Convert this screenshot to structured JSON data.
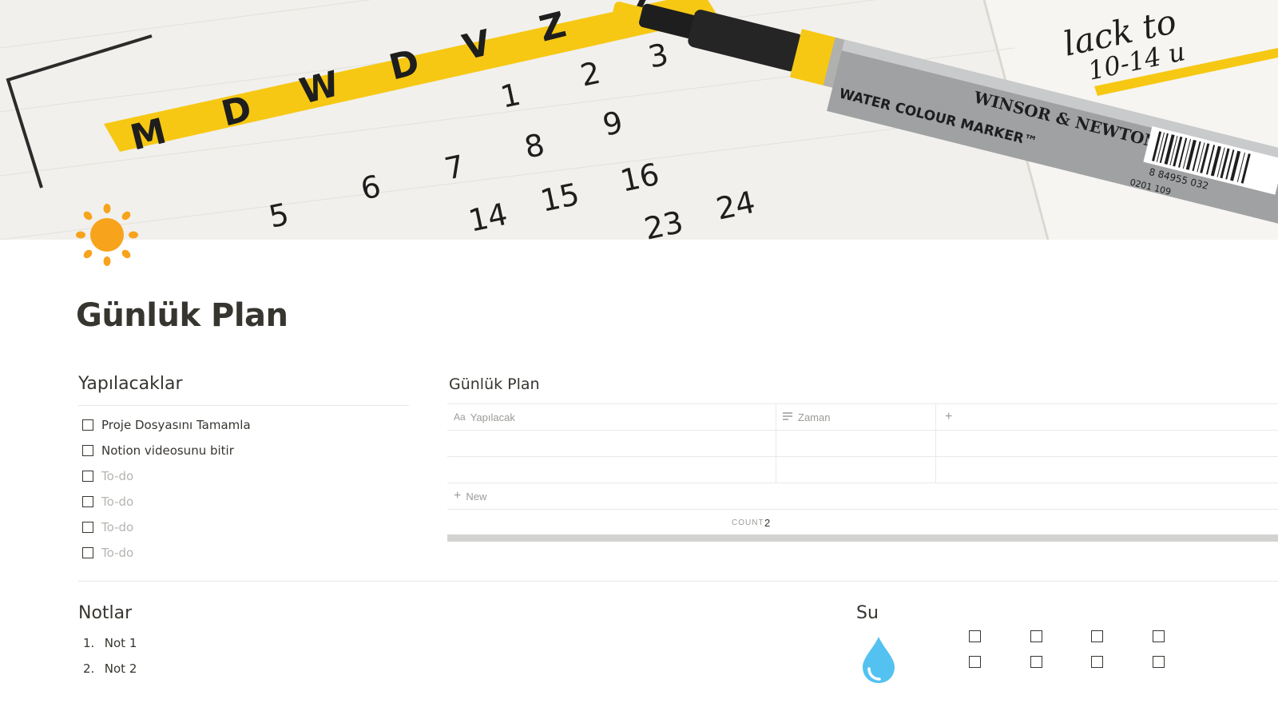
{
  "page": {
    "icon": "sun-icon",
    "title": "Günlük Plan",
    "cover": {
      "weekday_letters": [
        "M",
        "D",
        "W",
        "D",
        "V",
        "Z",
        "Z"
      ],
      "calendar_numbers": [
        "1",
        "2",
        "3",
        "5",
        "6",
        "7",
        "8",
        "9",
        "14",
        "15",
        "16",
        "23",
        "24"
      ],
      "marker_text_top": "WINSOR & NEWTON",
      "marker_text_main": "WATER COLOUR MARKER™",
      "barcode_number": "8 84955 032",
      "marker_code": "0201 109",
      "note_line_1": "lack to",
      "note_line_2": "10-14 u"
    }
  },
  "todo_section": {
    "heading": "Yapılacaklar",
    "items": [
      {
        "label": "Proje Dosyasını Tamamla",
        "placeholder": false
      },
      {
        "label": "Notion videosunu bitir",
        "placeholder": false
      },
      {
        "label": "To-do",
        "placeholder": true
      },
      {
        "label": "To-do",
        "placeholder": true
      },
      {
        "label": "To-do",
        "placeholder": true
      },
      {
        "label": "To-do",
        "placeholder": true
      }
    ]
  },
  "database": {
    "title": "Günlük Plan",
    "columns": [
      {
        "name": "Yapılacak",
        "icon": "Aa"
      },
      {
        "name": "Zaman",
        "icon": "text-lines-icon"
      }
    ],
    "add_column_icon": "plus-icon",
    "row_count": 2,
    "new_label": "New",
    "count_label": "COUNT",
    "count_value": "2"
  },
  "notes_section": {
    "heading": "Notlar",
    "items": [
      {
        "num": "1.",
        "label": "Not 1"
      },
      {
        "num": "2.",
        "label": "Not 2"
      }
    ]
  },
  "water_section": {
    "heading": "Su",
    "icon": "water-drop-icon",
    "checkbox_rows": 2,
    "checkbox_cols": 4
  },
  "colors": {
    "text": "#37352f",
    "muted": "#9b9a97",
    "placeholder": "#b4b4b0",
    "sun": "#f7a31c",
    "drop": "#53c2f0",
    "marker_yellow": "#f6c814"
  }
}
